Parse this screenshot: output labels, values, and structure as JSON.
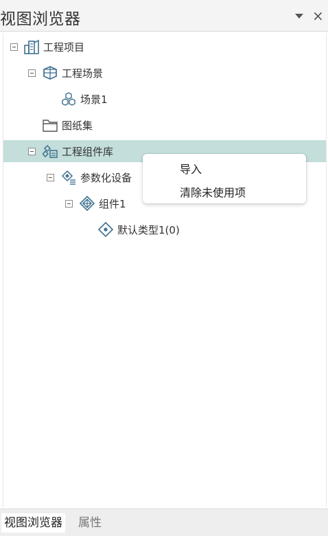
{
  "panel": {
    "title": "视图浏览器"
  },
  "tree": {
    "nodes": [
      {
        "label": "工程项目",
        "icon": "building-icon"
      },
      {
        "label": "工程场景",
        "icon": "scene-box-icon"
      },
      {
        "label": "场景1",
        "icon": "cubes-icon"
      },
      {
        "label": "图纸集",
        "icon": "folder-icon"
      },
      {
        "label": "工程组件库",
        "icon": "component-library-icon",
        "selected": true
      },
      {
        "label": "参数化设备",
        "icon": "parametric-device-icon"
      },
      {
        "label": "组件1",
        "icon": "component-icon"
      },
      {
        "label": "默认类型1(0)",
        "icon": "type-diamond-icon"
      }
    ]
  },
  "context_menu": {
    "items": [
      "导入",
      "清除未使用项"
    ]
  },
  "tabs": {
    "items": [
      "视图浏览器",
      "属性"
    ],
    "active": "视图浏览器"
  },
  "colors": {
    "selection": "#c3dedb",
    "icon": "#3d6f8e"
  }
}
